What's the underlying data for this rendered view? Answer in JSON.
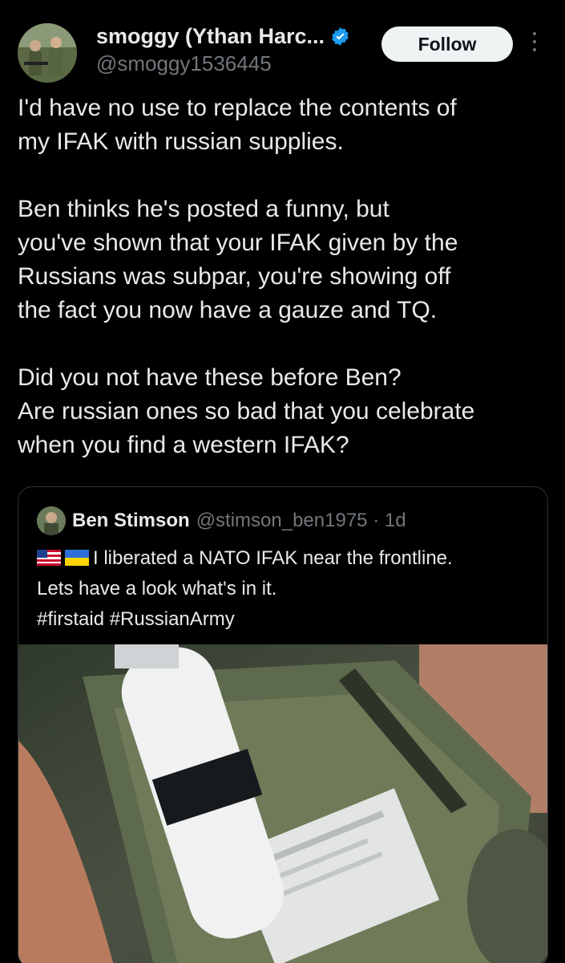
{
  "author": {
    "display_name": "smoggy (Ythan Harc...",
    "handle": "@smoggy1536445",
    "verified_icon": "verified-badge-icon",
    "verified_color": "#1d9bf0"
  },
  "actions": {
    "follow_label": "Follow",
    "more_icon": "more-vertical-icon"
  },
  "tweet": {
    "p1_l1": "I'd have no use to replace the contents of",
    "p1_l2": "my IFAK with russian supplies.",
    "p2_l1": "Ben thinks he's posted a funny, but",
    "p2_l2": "you've shown that your IFAK given by the",
    "p2_l3": "Russians was subpar, you're showing off",
    "p2_l4": "the fact you now have a gauze and TQ.",
    "p3_l1": "Did you not have these before Ben?",
    "p3_l2": "Are russian ones so bad that you celebrate",
    "p3_l3": "when you find a western IFAK?"
  },
  "quoted": {
    "display_name": "Ben Stimson",
    "handle_time": "@stimson_ben1975 · 1d",
    "flags": [
      "us-flag-icon",
      "ukraine-flag-icon"
    ],
    "line1": "I liberated a NATO IFAK near the frontline.",
    "line2": "Lets have a look what's in it.",
    "line3": "#firstaid #RussianArmy"
  }
}
